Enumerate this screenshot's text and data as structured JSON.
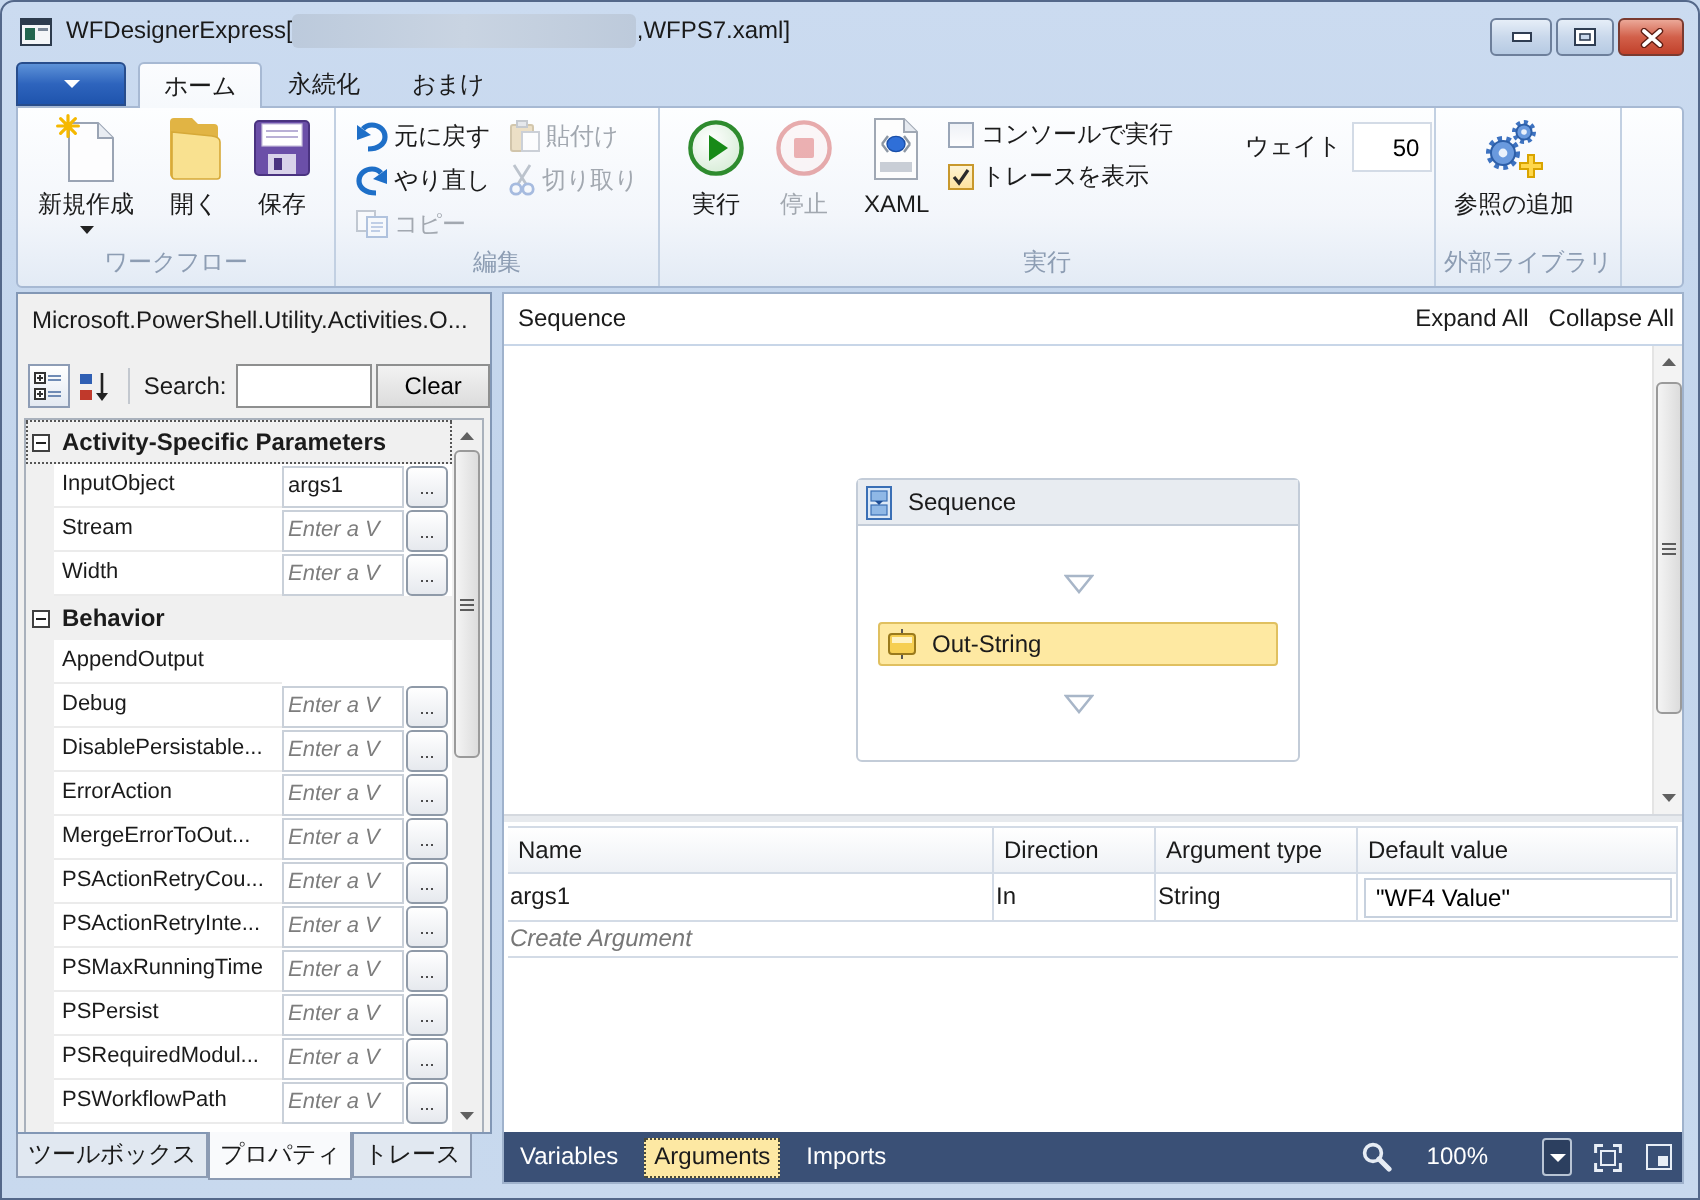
{
  "window": {
    "title_start": "WFDesignerExpress[",
    "title_end": ",WFPS7.xaml]"
  },
  "ribbon": {
    "tabs": [
      {
        "label": "ホーム",
        "selected": true
      },
      {
        "label": "永続化",
        "selected": false
      },
      {
        "label": "おまけ",
        "selected": false
      }
    ],
    "workflow_group": {
      "label": "ワークフロー",
      "new_button": {
        "label": "新規作成",
        "dropdown": true
      },
      "open_button": {
        "label": "開く"
      },
      "save_button": {
        "label": "保存"
      }
    },
    "edit_group": {
      "label": "編集",
      "undo_button": {
        "label": "元に戻す",
        "disabled": false
      },
      "paste_button": {
        "label": "貼付け",
        "disabled": true
      },
      "redo_button": {
        "label": "やり直し",
        "disabled": false
      },
      "cut_button": {
        "label": "切り取り",
        "disabled": true
      },
      "copy_button": {
        "label": "コピー",
        "disabled": true
      }
    },
    "run_group": {
      "label": "実行",
      "run_button": {
        "label": "実行",
        "disabled": false
      },
      "stop_button": {
        "label": "停止",
        "disabled": true
      },
      "xaml_button": {
        "label": "XAML"
      },
      "console_checkbox": {
        "label": "コンソールで実行",
        "checked": false
      },
      "trace_checkbox": {
        "label": "トレースを表示",
        "checked": true
      },
      "wait_field": {
        "label": "ウェイト",
        "value": "50"
      }
    },
    "library_group": {
      "label": "外部ライブラリ",
      "add_reference_button": {
        "label": "参照の追加"
      }
    }
  },
  "properties_panel": {
    "title": "Microsoft.PowerShell.Utility.Activities.O...",
    "view_buttons": [
      {
        "kind": "categorized",
        "selected": true
      },
      {
        "kind": "alphabetical",
        "selected": false
      }
    ],
    "search_label": "Search:",
    "clear_button": "Clear",
    "categories": [
      {
        "label": "Activity-Specific Parameters",
        "expanded": true,
        "focused": true,
        "properties": [
          {
            "name": "InputObject",
            "kind": "field",
            "value": "args1",
            "button": "..."
          },
          {
            "name": "Stream",
            "kind": "field",
            "placeholder": "Enter a V",
            "button": "..."
          },
          {
            "name": "Width",
            "kind": "field",
            "placeholder": "Enter a V",
            "button": "..."
          }
        ]
      },
      {
        "label": "Behavior",
        "expanded": true,
        "focused": false,
        "properties": [
          {
            "name": "AppendOutput",
            "kind": "blank"
          },
          {
            "name": "Debug",
            "kind": "field",
            "placeholder": "Enter a V",
            "button": "..."
          },
          {
            "name": "DisablePersistable...",
            "kind": "field",
            "placeholder": "Enter a V",
            "button": "..."
          },
          {
            "name": "ErrorAction",
            "kind": "field",
            "placeholder": "Enter a V",
            "button": "..."
          },
          {
            "name": "MergeErrorToOut...",
            "kind": "field",
            "placeholder": "Enter a V",
            "button": "..."
          },
          {
            "name": "PSActionRetryCou...",
            "kind": "field",
            "placeholder": "Enter a V",
            "button": "..."
          },
          {
            "name": "PSActionRetryInte...",
            "kind": "field",
            "placeholder": "Enter a V",
            "button": "..."
          },
          {
            "name": "PSMaxRunningTime",
            "kind": "field",
            "placeholder": "Enter a V",
            "button": "..."
          },
          {
            "name": "PSPersist",
            "kind": "field",
            "placeholder": "Enter a V",
            "button": "..."
          },
          {
            "name": "PSRequiredModul...",
            "kind": "field",
            "placeholder": "Enter a V",
            "button": "..."
          },
          {
            "name": "PSWorkflowPath",
            "kind": "field",
            "placeholder": "Enter a V",
            "button": "..."
          }
        ]
      }
    ],
    "tabs": [
      {
        "label": "ツールボックス",
        "selected": false
      },
      {
        "label": "プロパティ",
        "selected": true
      },
      {
        "label": "トレース",
        "selected": false
      }
    ]
  },
  "designer": {
    "breadcrumb": "Sequence",
    "expand_all": "Expand All",
    "collapse_all": "Collapse All",
    "sequence": {
      "title": "Sequence",
      "activities": [
        {
          "title": "Out-String",
          "selected": true
        }
      ]
    },
    "arguments": {
      "columns": [
        "Name",
        "Direction",
        "Argument type",
        "Default value"
      ],
      "rows": [
        {
          "name": "args1",
          "direction": "In",
          "argument_type": "String",
          "default_value": "\"WF4 Value\""
        }
      ],
      "create_label": "Create Argument"
    }
  },
  "status_bar": {
    "tabs": [
      {
        "label": "Variables",
        "selected": false
      },
      {
        "label": "Arguments",
        "selected": true
      },
      {
        "label": "Imports",
        "selected": false
      }
    ],
    "zoom": "100%"
  }
}
